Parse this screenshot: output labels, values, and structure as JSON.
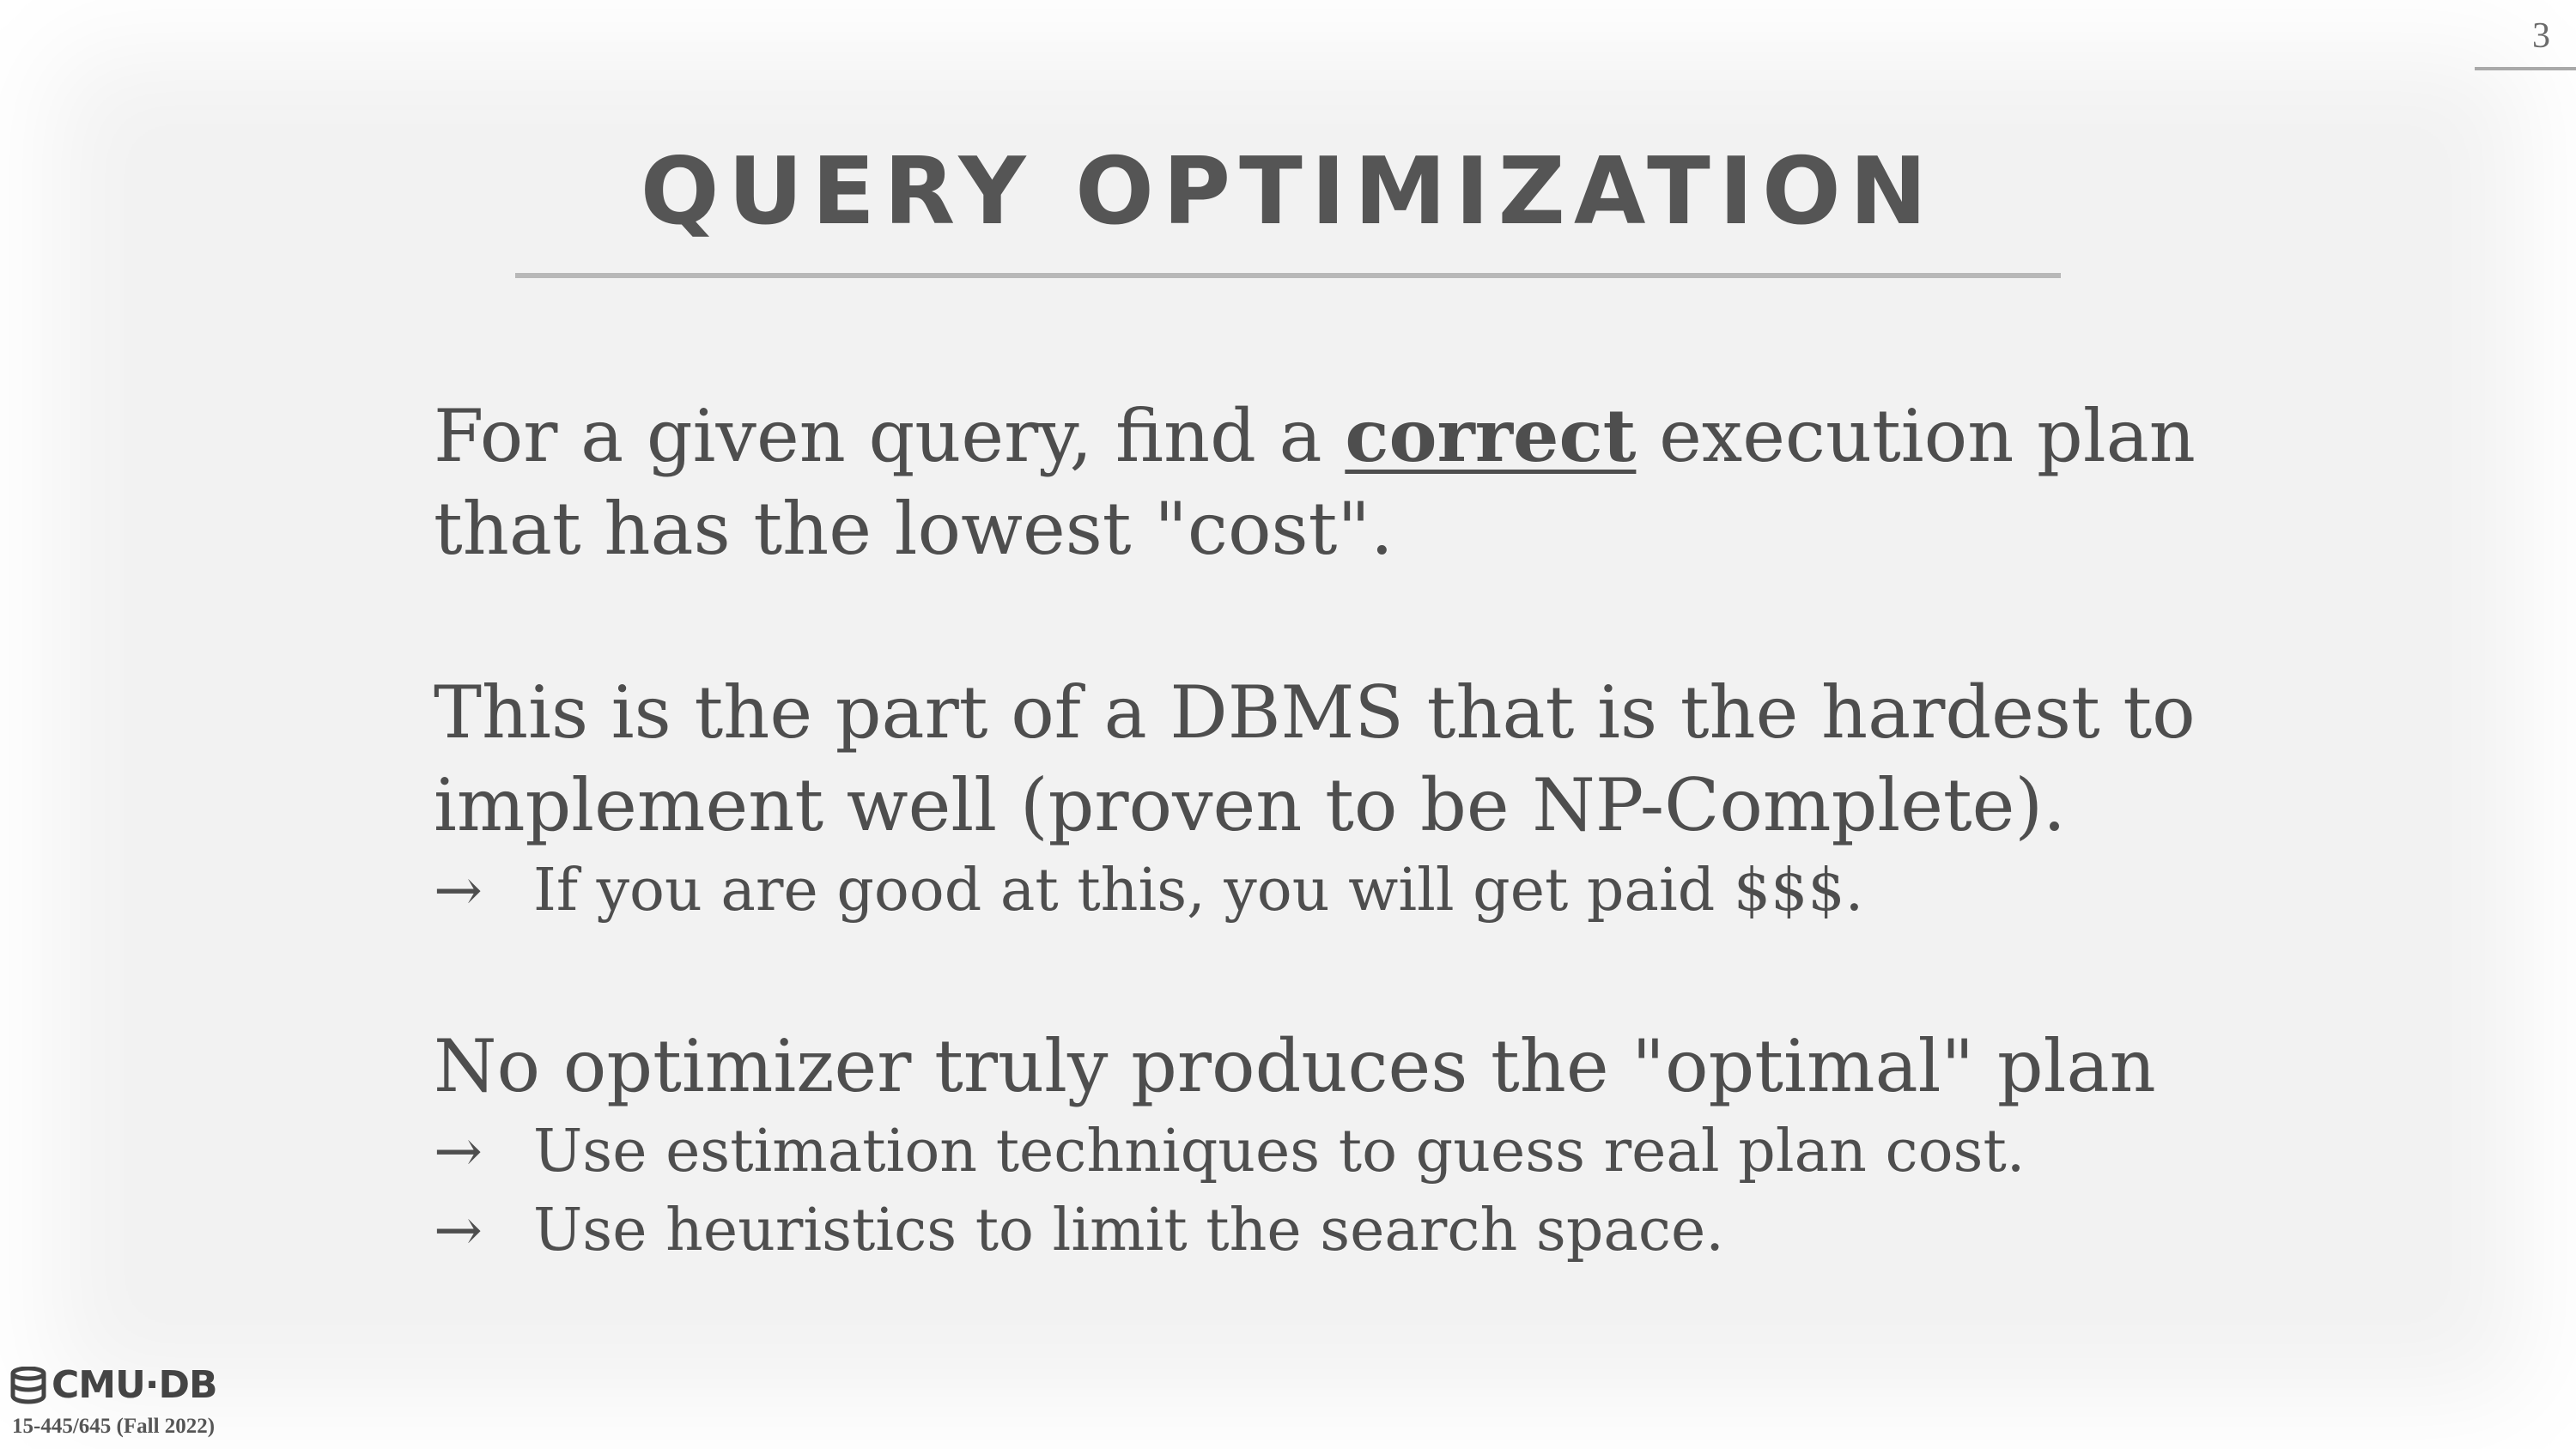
{
  "page_number": "3",
  "title": "QUERY OPTIMIZATION",
  "paragraph1": {
    "line1_before": "For a given query, find a ",
    "line1_emphasis": "correct",
    "line1_after": " execution plan",
    "line2": "that has the lowest \"cost\"."
  },
  "paragraph2": {
    "line1": "This is the part of a DBMS that is the hardest to",
    "line2": "implement well (proven to be NP-Complete).",
    "bullets": [
      "If you are good at this, you will get paid $$$."
    ]
  },
  "paragraph3": {
    "line1": "No optimizer truly produces the \"optimal\" plan",
    "bullets": [
      "Use estimation techniques to guess real plan cost.",
      "Use heuristics to limit the search space."
    ]
  },
  "bullet_arrow": "→",
  "footer": {
    "logo_text": "CMU·DB",
    "course": "15-445/645 (Fall 2022)"
  }
}
